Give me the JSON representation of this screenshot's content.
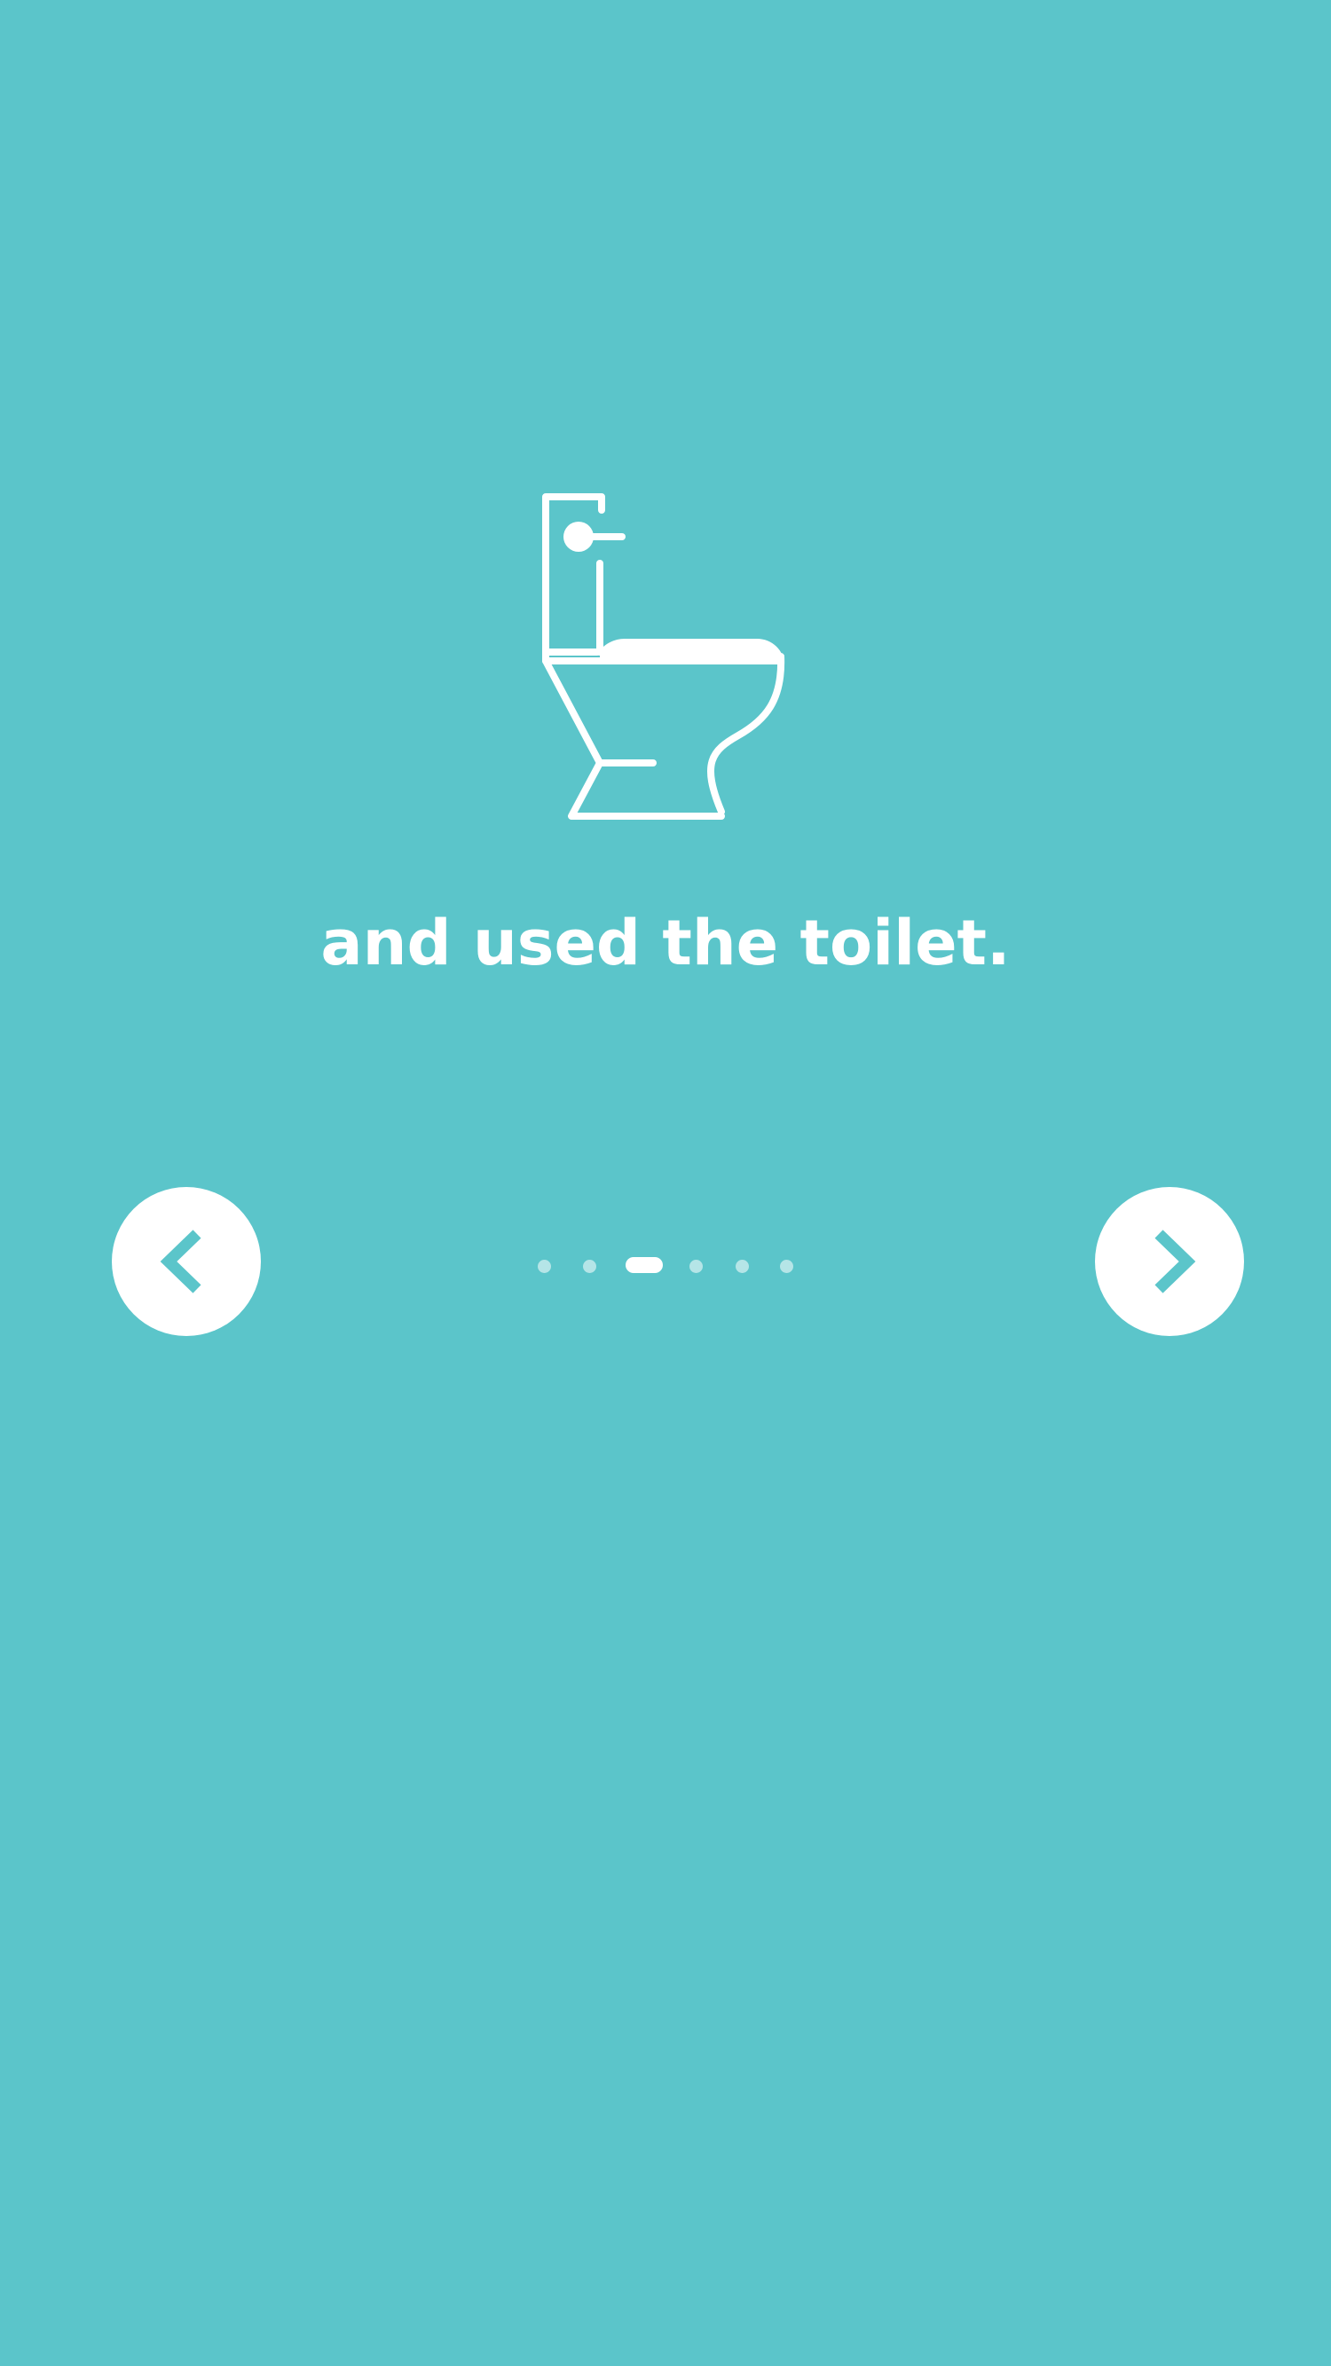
{
  "screen": {
    "background_color": "#5BC5CA",
    "accent_color": "#FFFFFF"
  },
  "illustration": {
    "icon": "toilet-icon"
  },
  "caption": {
    "text": "and used the toilet."
  },
  "navigation": {
    "prev_icon": "chevron-left-icon",
    "next_icon": "chevron-right-icon"
  },
  "pagination": {
    "total_pages": 6,
    "current_page": 3
  }
}
